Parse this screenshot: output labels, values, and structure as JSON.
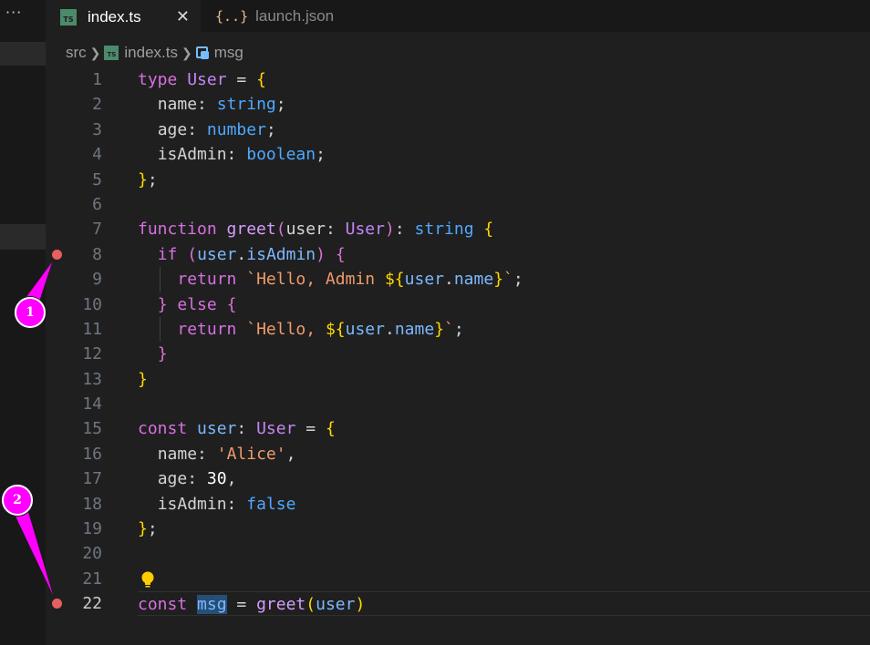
{
  "sidebar": {
    "more_label": "···"
  },
  "tabs": [
    {
      "label": "index.ts",
      "icon": "ts-file-icon",
      "active": true,
      "close": "✕"
    },
    {
      "label": "launch.json",
      "icon": "json-file-icon",
      "active": false,
      "icon_text": "{..}"
    }
  ],
  "breadcrumb": {
    "folder": "src",
    "file": "index.ts",
    "symbol": "msg",
    "file_icon_text": "TS"
  },
  "editor": {
    "lines": [
      {
        "n": "1"
      },
      {
        "n": "2"
      },
      {
        "n": "3"
      },
      {
        "n": "4"
      },
      {
        "n": "5"
      },
      {
        "n": "6"
      },
      {
        "n": "7"
      },
      {
        "n": "8"
      },
      {
        "n": "9"
      },
      {
        "n": "10"
      },
      {
        "n": "11"
      },
      {
        "n": "12"
      },
      {
        "n": "13"
      },
      {
        "n": "14"
      },
      {
        "n": "15"
      },
      {
        "n": "16"
      },
      {
        "n": "17"
      },
      {
        "n": "18"
      },
      {
        "n": "19"
      },
      {
        "n": "20"
      },
      {
        "n": "21"
      },
      {
        "n": "22"
      }
    ],
    "current_line": "22",
    "breakpoints": [
      "8",
      "22"
    ],
    "code_text": {
      "l1": [
        "type",
        " ",
        "User",
        " ",
        "=",
        " ",
        "{"
      ],
      "l2": [
        "  ",
        "name",
        ":",
        " ",
        "string",
        ";"
      ],
      "l3": [
        "  ",
        "age",
        ":",
        " ",
        "number",
        ";"
      ],
      "l4": [
        "  ",
        "isAdmin",
        ":",
        " ",
        "boolean",
        ";"
      ],
      "l5": [
        "}",
        ";"
      ],
      "l7": [
        "function",
        " ",
        "greet",
        "(",
        "user",
        ":",
        " ",
        "User",
        ")",
        ":",
        " ",
        "string",
        " ",
        "{"
      ],
      "l8": [
        "  ",
        "if",
        " ",
        "(",
        "user",
        ".",
        "isAdmin",
        ")",
        " ",
        "{"
      ],
      "l9": [
        "    ",
        "return",
        " ",
        "`Hello, Admin ",
        "${",
        "user",
        ".",
        "name",
        "}",
        "`",
        ";"
      ],
      "l10": [
        "  ",
        "}",
        " ",
        "else",
        " ",
        "{"
      ],
      "l11": [
        "    ",
        "return",
        " ",
        "`Hello, ",
        "${",
        "user",
        ".",
        "name",
        "}",
        "`",
        ";"
      ],
      "l12": [
        "  ",
        "}"
      ],
      "l13": [
        "}"
      ],
      "l15": [
        "const",
        " ",
        "user",
        ":",
        " ",
        "User",
        " ",
        "=",
        " ",
        "{"
      ],
      "l16": [
        "  ",
        "name",
        ":",
        " ",
        "'Alice'",
        ","
      ],
      "l17": [
        "  ",
        "age",
        ":",
        " ",
        "30",
        ","
      ],
      "l18": [
        "  ",
        "isAdmin",
        ":",
        " ",
        "false"
      ],
      "l19": [
        "}",
        ";"
      ],
      "l22": [
        "const",
        " ",
        "msg",
        " ",
        "=",
        " ",
        "greet",
        "(",
        "user",
        ")"
      ]
    }
  },
  "annotations": [
    {
      "label": "1"
    },
    {
      "label": "2"
    }
  ],
  "colors": {
    "breakpoint": "#e85f5f",
    "annotation": "#ff00ff",
    "bulb": "#ffcc00",
    "selection": "#264f78"
  }
}
